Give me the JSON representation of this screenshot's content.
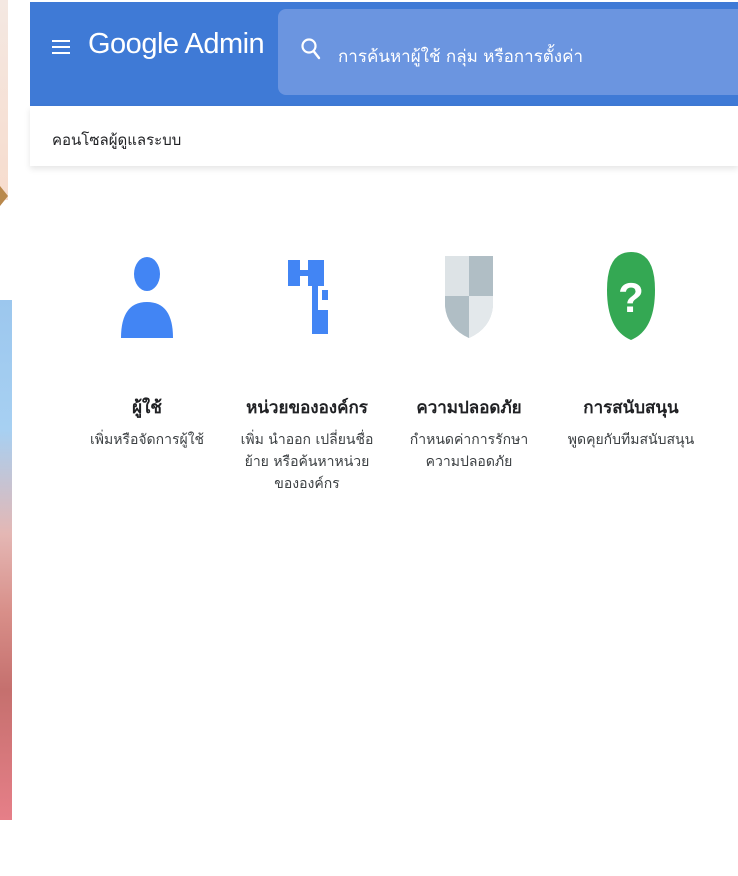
{
  "app": {
    "title": "Google Admin"
  },
  "header": {
    "menu_icon": "hamburger-menu-icon",
    "search_icon": "search-icon",
    "search_placeholder": "การค้นหาผู้ใช้ กลุ่ม หรือการตั้งค่า",
    "bar_color": "#3f7ad6"
  },
  "breadcrumb": {
    "label": "คอนโซลผู้ดูแลระบบ"
  },
  "tiles": [
    {
      "icon": "person-icon",
      "title": "ผู้ใช้",
      "desc_lines": [
        "เพิ่มหรือจัดการผู้ใช้"
      ],
      "color": "#4285f4"
    },
    {
      "icon": "org-tree-icon",
      "title": "หน่วยขององค์กร",
      "desc_lines": [
        "เพิ่ม นำออก เปลี่ยนชื่อ",
        "ย้าย หรือค้นหาหน่วย",
        "ขององค์กร"
      ],
      "color": "#4285f4"
    },
    {
      "icon": "shield-icon",
      "title": "ความปลอดภัย",
      "desc_lines": [
        "กำหนดค่าการรักษา",
        "ความปลอดภัย"
      ],
      "color": "#b0bec5"
    },
    {
      "icon": "help-question-icon",
      "title": "การสนับสนุน",
      "desc_lines": [
        "พูดคุยกับทีมสนับสนุน"
      ],
      "color": "#34a853"
    }
  ]
}
